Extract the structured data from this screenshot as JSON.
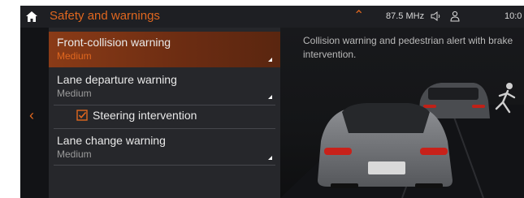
{
  "header": {
    "title": "Safety and warnings",
    "radio": "87.5 MHz",
    "clock": "10:0"
  },
  "menu": {
    "items": [
      {
        "label": "Front-collision warning",
        "value": "Medium"
      },
      {
        "label": "Lane departure warning",
        "value": "Medium"
      },
      {
        "label": "Lane change warning",
        "value": "Medium"
      }
    ],
    "sub_option": {
      "label": "Steering intervention",
      "checked": true
    }
  },
  "info": {
    "description": "Collision warning and pedestrian alert with brake intervention."
  },
  "colors": {
    "accent": "#e0671f",
    "background": "#17181b",
    "selected_row": "#7a3314"
  }
}
